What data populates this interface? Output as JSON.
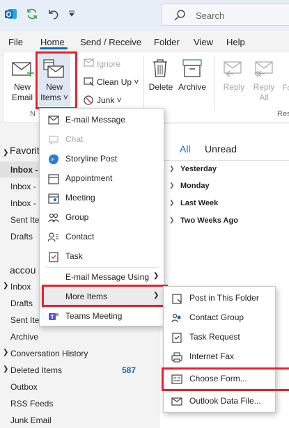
{
  "titlebar": {
    "search_placeholder": "Search"
  },
  "tabs": [
    "File",
    "Home",
    "Send / Receive",
    "Folder",
    "View",
    "Help"
  ],
  "ribbon": {
    "new_email": [
      "New",
      "Email"
    ],
    "new_items": [
      "New",
      "Items ˅"
    ],
    "ignore": "Ignore",
    "clean_up": "Clean Up ˅",
    "junk": "Junk ˅",
    "delete": "Delete",
    "archive": "Archive",
    "reply": "Reply",
    "reply_all": [
      "Reply",
      "All"
    ],
    "forward_partial": "Fo",
    "group_label_new": "N",
    "group_label_res": "Res"
  },
  "leftpane": {
    "favorites": "Favorit",
    "fav_items": [
      "Inbox -",
      "Inbox -",
      "Inbox -",
      "Sent Ite",
      "Drafts"
    ],
    "account": "accou",
    "acct_items": [
      "Inbox",
      "Drafts",
      "Sent Ite",
      "Archive",
      "Conversation History",
      "Deleted Items",
      "Outbox",
      "RSS Feeds",
      "Junk Email"
    ],
    "deleted_count": "587"
  },
  "msglist": {
    "filter_all": "All",
    "filter_unread": "Unread",
    "groups": [
      "Yesterday",
      "Monday",
      "Last Week",
      "Two Weeks Ago"
    ]
  },
  "menu1": {
    "items": [
      "E-mail Message",
      "Chat",
      "Storyline Post",
      "Appointment",
      "Meeting",
      "Group",
      "Contact",
      "Task",
      "E-mail Message Using",
      "More Items",
      "Teams Meeting"
    ]
  },
  "menu2": {
    "items": [
      "Post in This Folder",
      "Contact Group",
      "Task Request",
      "Internet Fax",
      "Choose Form...",
      "Outlook Data File..."
    ]
  },
  "colors": {
    "accent": "#0f6cbd",
    "highlight": "#e8212e"
  }
}
